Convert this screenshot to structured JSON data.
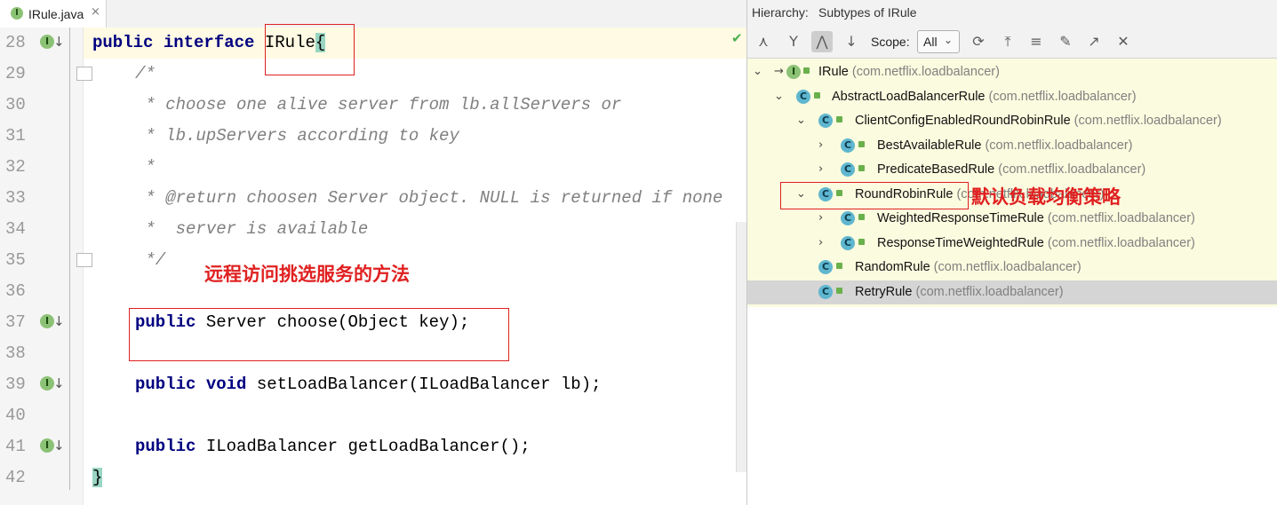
{
  "editor": {
    "tab": {
      "icon": "interface-icon",
      "icon_letter": "I",
      "label": "IRule.java",
      "close": "×"
    },
    "line_numbers": [
      "28",
      "29",
      "30",
      "31",
      "32",
      "33",
      "34",
      "35",
      "36",
      "37",
      "38",
      "39",
      "40",
      "41",
      "42"
    ],
    "impl_icon_letter": "I",
    "impl_arrow": "↓",
    "lines": {
      "l28": {
        "kw1": "public",
        "kw2": "interface",
        "name": "IRule",
        "brace": "{"
      },
      "l29": "/*",
      "l30": " * choose one alive server from lb.allServers or",
      "l31": " * lb.upServers according to key",
      "l32": " *",
      "l33": " * @return choosen Server object. NULL is returned if none",
      "l34": " *  server is available",
      "l35": " */",
      "l37": {
        "kw": "public",
        "rest": " Server choose(Object key);"
      },
      "l39": {
        "kw1": "public",
        "kw2": "void",
        "rest": " setLoadBalancer(ILoadBalancer lb);"
      },
      "l41": {
        "kw": "public",
        "rest": " ILoadBalancer getLoadBalancer();"
      },
      "l42": "}"
    },
    "status_check": "✔",
    "annotation": "远程访问挑选服务的方法"
  },
  "hierarchy": {
    "title_label": "Hierarchy:",
    "title_value": "Subtypes of IRule",
    "toolbar": {
      "scope_label": "Scope:",
      "scope_value": "All",
      "icons": [
        "class-hierarchy-icon",
        "supertypes-icon",
        "subtypes-icon",
        "sort-alpha-icon",
        "refresh-icon",
        "export-icon",
        "expand-all-icon",
        "pin-icon",
        "open-editor-icon",
        "close-icon"
      ]
    },
    "annotation": "默认负载均衡策略",
    "rows": [
      {
        "name": "IRule",
        "pkg": "(com.netflix.loadbalancer)",
        "type": "interface",
        "letter": "I",
        "chevron": "⌄"
      },
      {
        "name": "AbstractLoadBalancerRule",
        "pkg": "(com.netflix.loadbalancer)",
        "type": "class",
        "letter": "C",
        "chevron": "⌄"
      },
      {
        "name": "ClientConfigEnabledRoundRobinRule",
        "pkg": "(com.netflix.loadbalancer)",
        "type": "class",
        "letter": "C",
        "chevron": "⌄"
      },
      {
        "name": "BestAvailableRule",
        "pkg": "(com.netflix.loadbalancer)",
        "type": "class",
        "letter": "C",
        "chevron": "›"
      },
      {
        "name": "PredicateBasedRule",
        "pkg": "(com.netflix.loadbalancer)",
        "type": "class",
        "letter": "C",
        "chevron": "›"
      },
      {
        "name": "RoundRobinRule",
        "pkg": "(com.netflix.loadbalancer)",
        "type": "class",
        "letter": "C",
        "chevron": "⌄"
      },
      {
        "name": "WeightedResponseTimeRule",
        "pkg": "(com.netflix.loadbalancer)",
        "type": "class",
        "letter": "C",
        "chevron": "›"
      },
      {
        "name": "ResponseTimeWeightedRule",
        "pkg": "(com.netflix.loadbalancer)",
        "type": "class",
        "letter": "C",
        "chevron": "›"
      },
      {
        "name": "RandomRule",
        "pkg": "(com.netflix.loadbalancer)",
        "type": "class",
        "letter": "C",
        "chevron": ""
      },
      {
        "name": "RetryRule",
        "pkg": "(com.netflix.loadbalancer)",
        "type": "class",
        "letter": "C",
        "chevron": ""
      }
    ]
  }
}
